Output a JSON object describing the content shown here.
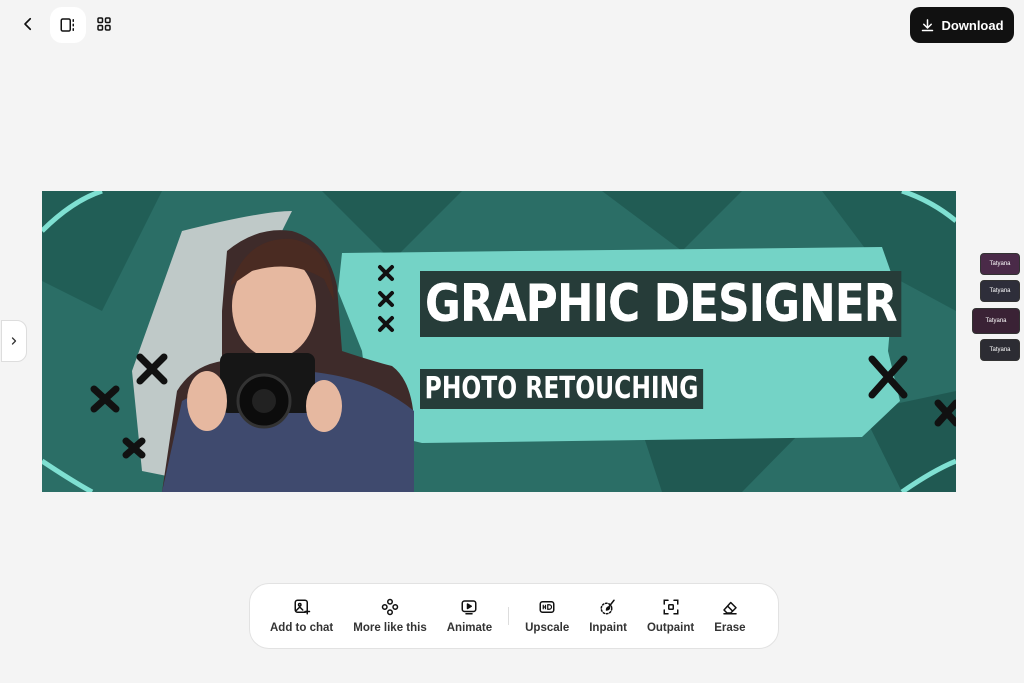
{
  "header": {
    "back_icon": "arrow-left-icon",
    "view_single_icon": "single-view-icon",
    "view_grid_icon": "grid-view-icon",
    "download_label": "Download"
  },
  "banner": {
    "headline": "GRAPHIC DESIGNER",
    "subline": "PHOTO RETOUCHING",
    "colors": {
      "background": "#2b6e66",
      "brush": "#74d3c6",
      "text_box": "#263c39"
    }
  },
  "thumbnails": [
    {
      "label": "Tatyana"
    },
    {
      "label": "Tatyana"
    },
    {
      "label": "Tatyana"
    },
    {
      "label": "Tatyana"
    }
  ],
  "toolbar": {
    "tools": [
      {
        "label": "Add to chat",
        "icon": "image-add-icon"
      },
      {
        "label": "More like this",
        "icon": "variations-icon"
      },
      {
        "label": "Animate",
        "icon": "animate-icon"
      },
      {
        "label": "Upscale",
        "icon": "hd-icon"
      },
      {
        "label": "Inpaint",
        "icon": "brush-icon"
      },
      {
        "label": "Outpaint",
        "icon": "expand-icon"
      },
      {
        "label": "Erase",
        "icon": "eraser-icon"
      }
    ]
  }
}
